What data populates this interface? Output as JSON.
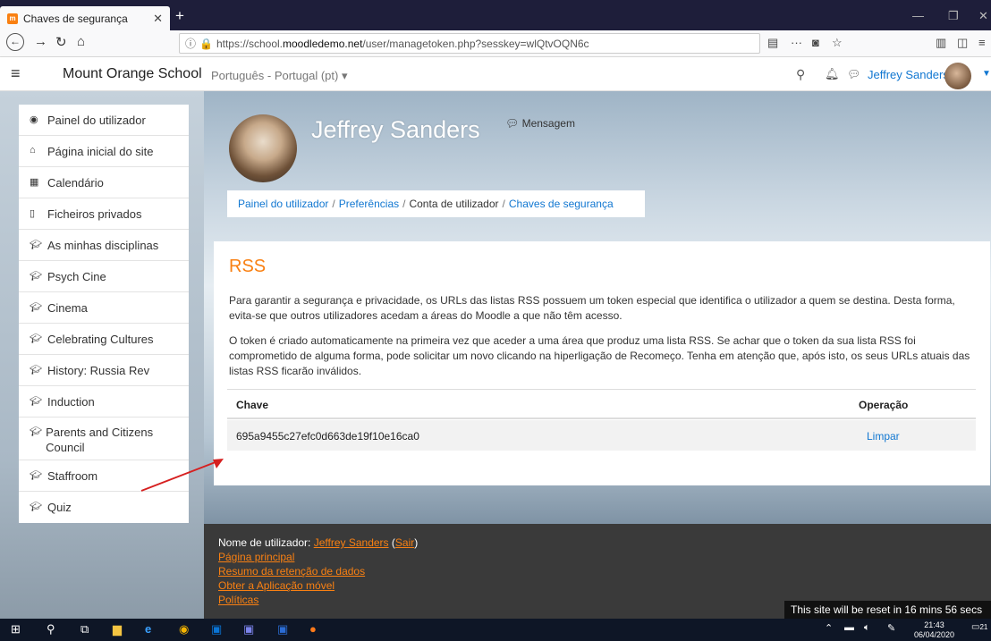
{
  "browser": {
    "tab_title": "Chaves de segurança",
    "tab_favicon": "m",
    "url_prefix": "https://school.",
    "url_domain": "moodledemo.net",
    "url_path": "/user/managetoken.php?sesskey=wlQtvOQN6c"
  },
  "header": {
    "site_name": "Mount Orange School",
    "language": "Português - Portugal (pt) ▾",
    "user_name": "Jeffrey Sanders"
  },
  "drawer": {
    "items": [
      {
        "label": "Painel do utilizador",
        "icon": "dashboard-icon"
      },
      {
        "label": "Página inicial do site",
        "icon": "home-icon"
      },
      {
        "label": "Calendário",
        "icon": "calendar-icon"
      },
      {
        "label": "Ficheiros privados",
        "icon": "file-icon"
      },
      {
        "label": "As minhas disciplinas",
        "icon": "graduation-cap-icon"
      },
      {
        "label": "Psych Cine",
        "icon": "graduation-cap-icon"
      },
      {
        "label": "Cinema",
        "icon": "graduation-cap-icon"
      },
      {
        "label": "Celebrating Cultures",
        "icon": "graduation-cap-icon"
      },
      {
        "label": "History: Russia Rev",
        "icon": "graduation-cap-icon"
      },
      {
        "label": "Induction",
        "icon": "graduation-cap-icon"
      },
      {
        "label": "Parents and Citizens Council",
        "icon": "graduation-cap-icon"
      },
      {
        "label": "Staffroom",
        "icon": "graduation-cap-icon"
      },
      {
        "label": "Quiz",
        "icon": "graduation-cap-icon"
      }
    ]
  },
  "profile": {
    "name": "Jeffrey Sanders",
    "message_label": "Mensagem"
  },
  "breadcrumb": {
    "items": [
      "Painel do utilizador",
      "Preferências",
      "Conta de utilizador",
      "Chaves de segurança"
    ]
  },
  "main": {
    "heading": "RSS",
    "para1": "Para garantir a segurança e privacidade, os URLs das listas RSS possuem um token especial que identifica o utilizador a quem se destina. Desta forma, evita-se que outros utilizadores acedam a áreas do Moodle a que não têm acesso.",
    "para2": "O token é criado automaticamente na primeira vez que aceder a uma área que produz uma lista RSS. Se achar que o token da sua lista RSS foi comprometido de alguma forma, pode solicitar um novo clicando na hiperligação de Recomeço. Tenha em atenção que, após isto, os seus URLs atuais das listas RSS ficarão inválidos.",
    "table": {
      "headers": [
        "Chave",
        "Operação"
      ],
      "rows": [
        [
          "695a9455c27efc0d663de19f10e16ca0",
          "Limpar"
        ]
      ]
    }
  },
  "footer": {
    "user_prefix": "Nome de utilizador: ",
    "user_name": "Jeffrey Sanders",
    "logout_label": "Sair",
    "links": [
      "Página principal",
      "Resumo da retenção de dados",
      "Obter a Aplicação móvel",
      "Políticas"
    ],
    "reset_notice": "This site will be reset in 16 mins 56 secs"
  },
  "taskbar": {
    "time": "21:43",
    "date": "06/04/2020",
    "notification_count": "21"
  },
  "colors": {
    "accent": "#f98012",
    "link": "#1177d1"
  }
}
